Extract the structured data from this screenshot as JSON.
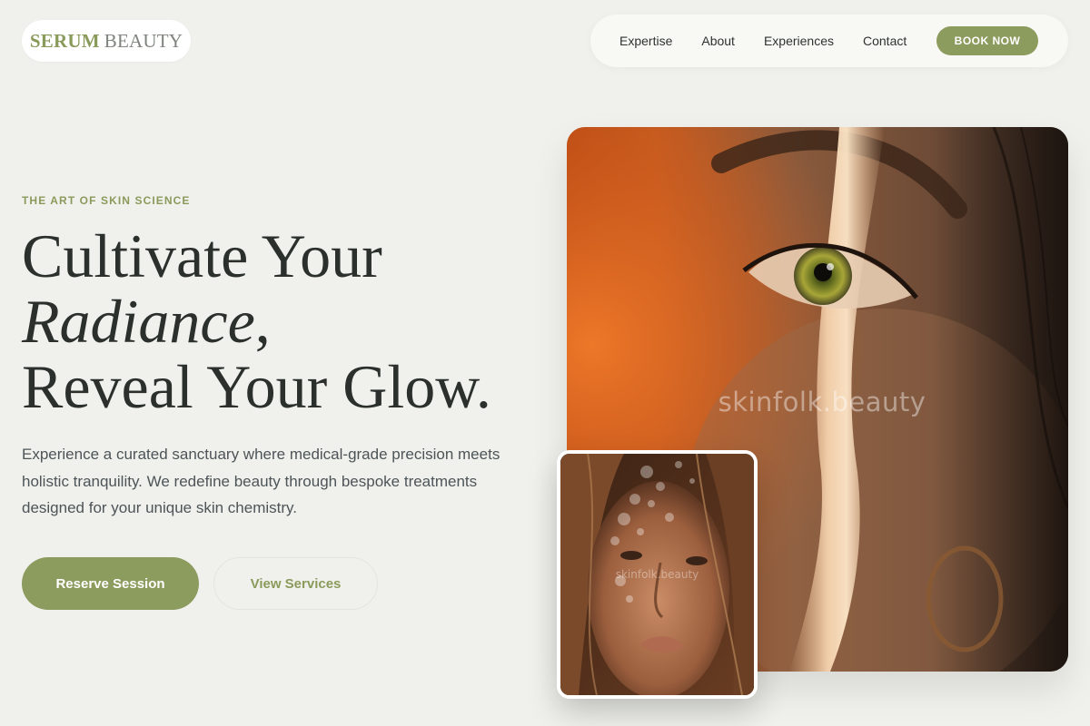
{
  "brand": {
    "strong": "SERUM",
    "light": "BEAUTY"
  },
  "nav": {
    "items": [
      {
        "label": "Expertise"
      },
      {
        "label": "About"
      },
      {
        "label": "Experiences"
      },
      {
        "label": "Contact"
      }
    ],
    "cta": "BOOK NOW"
  },
  "hero": {
    "eyebrow": "THE ART OF SKIN SCIENCE",
    "headline": {
      "line1": "Cultivate Your",
      "line2_italic": "Radiance",
      "line2_rest": ",",
      "line3": "Reveal Your Glow."
    },
    "description": "Experience a curated sanctuary where medical-grade precision meets holistic tranquility. We redefine beauty through bespoke treatments designed for your unique skin chemistry.",
    "primary_button": "Reserve Session",
    "secondary_button": "View Services"
  },
  "images": {
    "main_watermark": "skinfolk.beauty",
    "thumb_watermark": "skinfolk.beauty"
  },
  "colors": {
    "accent": "#8c9b5e",
    "background": "#f0f1ec",
    "heading": "#2c302d",
    "body_text": "#4d5458"
  }
}
